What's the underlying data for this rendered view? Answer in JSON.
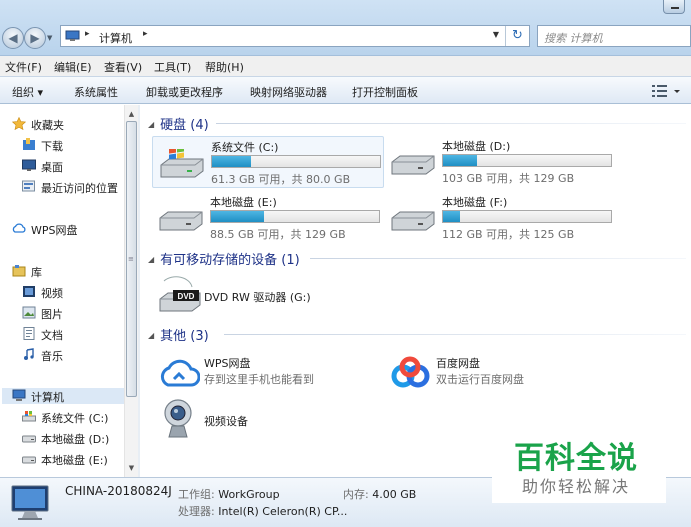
{
  "address": {
    "crumb": "计算机",
    "search_placeholder": "搜索 计算机"
  },
  "menu": [
    {
      "label": "文件(F)"
    },
    {
      "label": "编辑(E)"
    },
    {
      "label": "查看(V)"
    },
    {
      "label": "工具(T)"
    },
    {
      "label": "帮助(H)"
    }
  ],
  "commands": [
    {
      "label": "组织 ▾"
    },
    {
      "label": "系统属性"
    },
    {
      "label": "卸载或更改程序"
    },
    {
      "label": "映射网络驱动器"
    },
    {
      "label": "打开控制面板"
    }
  ],
  "nav": [
    {
      "label": "收藏夹",
      "icon": "star-icon"
    },
    {
      "label": "下载",
      "icon": "download-folder-icon"
    },
    {
      "label": "桌面",
      "icon": "desktop-icon"
    },
    {
      "label": "最近访问的位置",
      "icon": "recent-places-icon"
    },
    {
      "label": "WPS网盘",
      "icon": "cloud-icon"
    },
    {
      "label": "库",
      "icon": "library-icon"
    },
    {
      "label": "视频",
      "icon": "video-icon"
    },
    {
      "label": "图片",
      "icon": "pictures-icon"
    },
    {
      "label": "文档",
      "icon": "documents-icon"
    },
    {
      "label": "音乐",
      "icon": "music-icon"
    },
    {
      "label": "计算机",
      "icon": "computer-icon"
    },
    {
      "label": "系统文件 (C:)",
      "icon": "system-drive-icon"
    },
    {
      "label": "本地磁盘 (D:)",
      "icon": "drive-icon"
    },
    {
      "label": "本地磁盘 (E:)",
      "icon": "drive-icon"
    }
  ],
  "groups": {
    "hard_disks": "硬盘 (4)",
    "removable": "有可移动存储的设备 (1)",
    "other": "其他 (3)"
  },
  "drives": [
    {
      "name": "系统文件 (C:)",
      "free_text": "61.3 GB 可用，共 80.0 GB",
      "used_fraction": 0.234
    },
    {
      "name": "本地磁盘 (D:)",
      "free_text": "103 GB 可用，共 129 GB",
      "used_fraction": 0.2
    },
    {
      "name": "本地磁盘 (E:)",
      "free_text": "88.5 GB 可用，共 129 GB",
      "used_fraction": 0.314
    },
    {
      "name": "本地磁盘 (F:)",
      "free_text": "112 GB 可用，共 125 GB",
      "used_fraction": 0.104
    }
  ],
  "removable": {
    "name": "DVD RW 驱动器 (G:)",
    "icon_label": "DVD"
  },
  "other_items": [
    {
      "title": "WPS网盘",
      "subtitle": "存到这里手机也能看到"
    },
    {
      "title": "百度网盘",
      "subtitle": "双击运行百度网盘"
    },
    {
      "title": "视频设备"
    }
  ],
  "details": {
    "computer_name": "CHINA-20180824J",
    "workgroup_label": "工作组:",
    "workgroup": "WorkGroup",
    "memory_label": "内存:",
    "memory": "4.00 GB",
    "cpu_label": "处理器:",
    "cpu": "Intel(R) Celeron(R) CP..."
  },
  "watermark": {
    "line1": "百科全说",
    "line2": "助你轻松解决"
  },
  "colors": {
    "accent": "#1e3287",
    "bar_fill": "#26a0da",
    "watermark": "#1aa34a"
  }
}
